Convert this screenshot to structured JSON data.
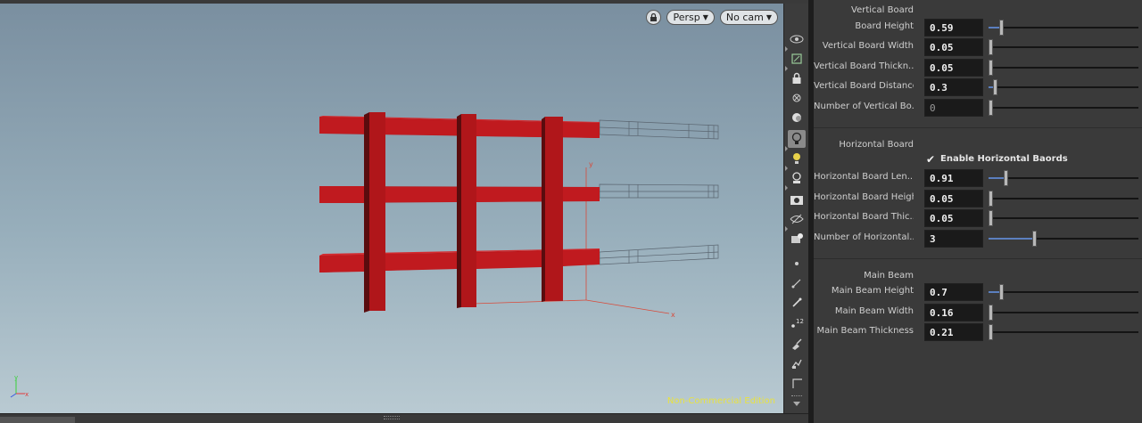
{
  "viewport": {
    "perspective_label": "Persp",
    "camera_label": "No cam",
    "watermark": "Non-Commercial Edition",
    "axis_y": "y",
    "axis_x": "x",
    "gizmo_y": "y",
    "gizmo_x": "x"
  },
  "shelf": {
    "tools": [
      "eye-icon",
      "display-options-icon",
      "lock-icon",
      "snap-icon",
      "ghost-icon",
      "light-bulb-icon",
      "light-icon",
      "camera-icon",
      "render-icon",
      "visibility-icon",
      "handle-icon",
      "point-icon",
      "normal-icon",
      "paint-icon",
      "number-icon",
      "brush-icon",
      "selection-icon",
      "corner-icon"
    ],
    "number_badge": "12"
  },
  "parameters": {
    "vertical": {
      "title": "Vertical Board",
      "rows": [
        {
          "label": "Board Height",
          "value": "0.59",
          "level": 0.07
        },
        {
          "label": "Vertical Board Width",
          "value": "0.05",
          "level": 0.0
        },
        {
          "label": "Vertical Board Thickn...",
          "value": "0.05",
          "level": 0.0
        },
        {
          "label": "Vertical Board Distance",
          "value": "0.3",
          "level": 0.03
        },
        {
          "label": "Number of Vertical Bo...",
          "value": "0",
          "level": 0.0
        }
      ]
    },
    "horizontal": {
      "title": "Horizontal Board",
      "toggle_label": "Enable Horizontal Baords",
      "rows": [
        {
          "label": "Horizontal Board Len...",
          "value": "0.91",
          "level": 0.1
        },
        {
          "label": "Horizontal Board Height",
          "value": "0.05",
          "level": 0.0
        },
        {
          "label": "Horizontal Board Thic...",
          "value": "0.05",
          "level": 0.0
        },
        {
          "label": "Number of Horizontal...",
          "value": "3",
          "level": 0.29
        }
      ]
    },
    "main_beam": {
      "title": "Main Beam",
      "rows": [
        {
          "label": "Main Beam Height",
          "value": "0.7",
          "level": 0.07
        },
        {
          "label": "Main Beam Width",
          "value": "0.16",
          "level": 0.0
        },
        {
          "label": "Main Beam Thickness",
          "value": "0.21",
          "level": 0.0
        }
      ]
    }
  },
  "colors": {
    "fence": "#b5161b",
    "accent": "#5b7fbf",
    "watermark": "#e8e240"
  }
}
